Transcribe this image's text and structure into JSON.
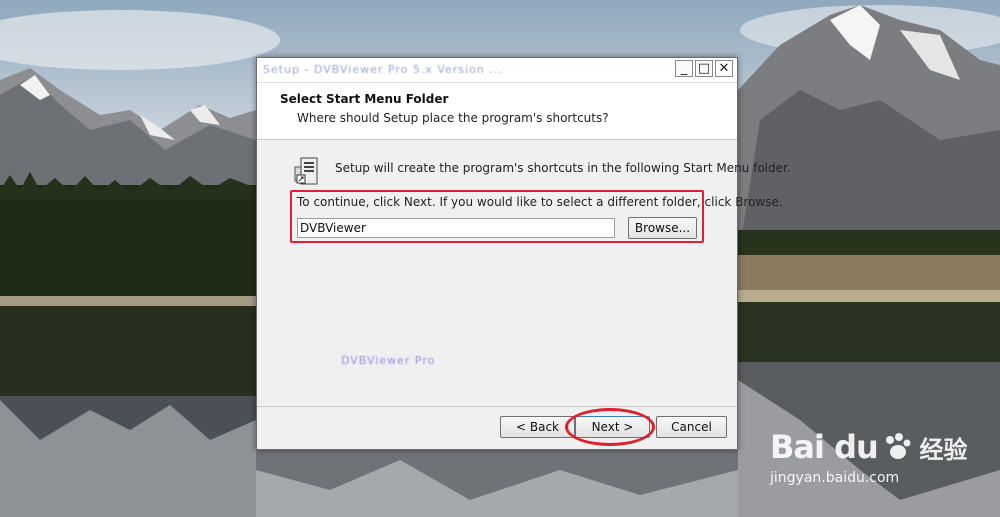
{
  "window": {
    "title": "Setup - DVBViewer Pro 5.x Version ...",
    "controls": {
      "minimize": "_",
      "maximize": "□",
      "close": "✕"
    }
  },
  "header": {
    "title": "Select Start Menu Folder",
    "subtitle": "Where should Setup place the program's shortcuts?"
  },
  "body": {
    "info_text": "Setup will create the program's shortcuts in the following Start Menu folder.",
    "continue_text": "To continue, click Next. If you would like to select a different folder, click Browse.",
    "folder_value": "DVBViewer",
    "browse_label": "Browse...",
    "watermark_text": "DVBViewer Pro"
  },
  "footer": {
    "back_label": "< Back",
    "next_label": "Next >",
    "cancel_label": "Cancel"
  },
  "watermark": {
    "logo": "Bai du",
    "cn": "经验",
    "url": "jingyan.baidu.com"
  },
  "colors": {
    "highlight": "#e0202a",
    "dialog_bg": "#f0f0f0"
  },
  "icons": [
    "folder-shortcut-icon",
    "paw-icon"
  ]
}
